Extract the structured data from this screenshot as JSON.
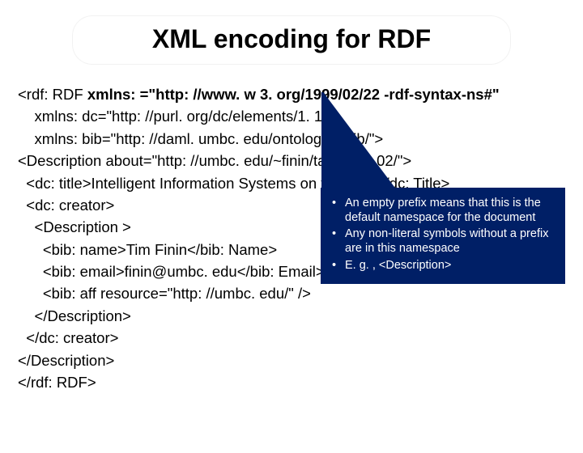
{
  "title": "XML encoding for RDF",
  "code": {
    "l1a": "<rdf: RDF ",
    "l1b": "xmlns: =\"http: //www. w 3. org/1999/02/22 -rdf-syntax-ns#\"",
    "l2": "    xmlns: dc=\"http: //purl. org/dc/elements/1. 1/\"",
    "l3": "    xmlns: bib=\"http: //daml. umbc. edu/ontologies/bib/\">",
    "l4": "<Description about=\"http: //umbc. edu/~finin/talks/idm 02/\">",
    "l5": "  <dc: title>Intelligent Information Systems on the Web</dc: Title>",
    "l6": "  <dc: creator>",
    "l7": "    <Description >",
    "l8": "      <bib: name>Tim Finin</bib: Name>",
    "l9": "      <bib: email>finin@umbc. edu</bib: Email>",
    "l10": "      <bib: aff resource=\"http: //umbc. edu/\" />",
    "l11": "    </Description>",
    "l12": "  </dc: creator>",
    "l13": "</Description>",
    "l14": "</rdf: RDF>"
  },
  "callout": {
    "b1": "An empty prefix means that this is the default namespace for the document",
    "b2": "Any non-literal symbols without a prefix are in this namespace",
    "b3": "E. g. , <Description>"
  }
}
